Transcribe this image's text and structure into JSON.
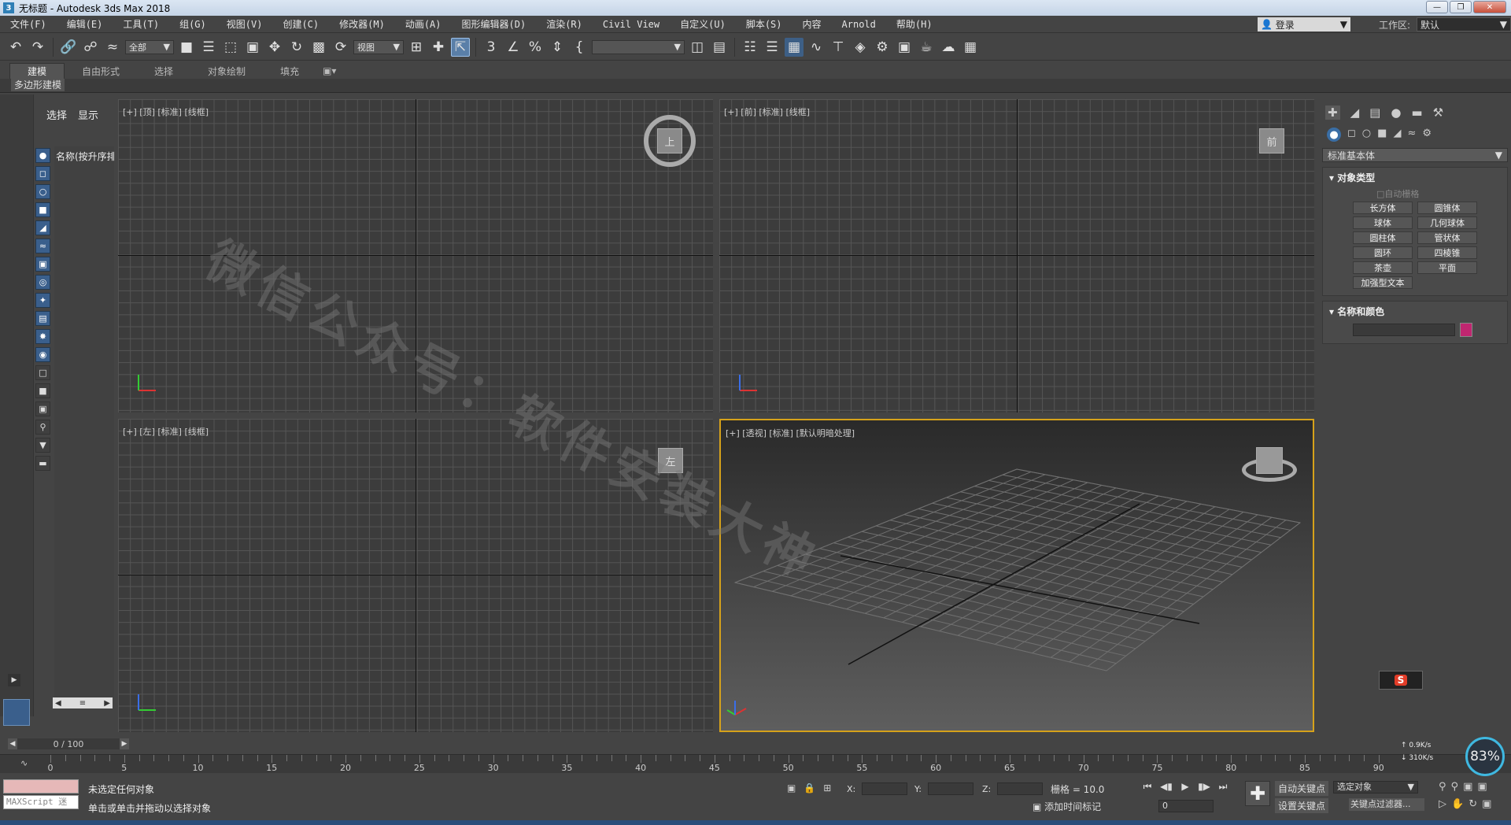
{
  "window": {
    "title": "无标题 - Autodesk 3ds Max 2018",
    "app_icon": "3"
  },
  "menu": [
    "文件(F)",
    "编辑(E)",
    "工具(T)",
    "组(G)",
    "视图(V)",
    "创建(C)",
    "修改器(M)",
    "动画(A)",
    "图形编辑器(D)",
    "渲染(R)",
    "Civil View",
    "自定义(U)",
    "脚本(S)",
    "内容",
    "Arnold",
    "帮助(H)"
  ],
  "account": {
    "login": "登录",
    "workspace_label": "工作区:",
    "workspace_value": "默认"
  },
  "toolbar": {
    "selection_filter": "全部",
    "ref_coord": "视图"
  },
  "ribbon": {
    "tabs": [
      "建模",
      "自由形式",
      "选择",
      "对象绘制",
      "填充"
    ],
    "active": "建模",
    "sub": "多边形建模"
  },
  "scene_explorer": {
    "tabs": [
      "选择",
      "显示"
    ],
    "column_header": "名称(按升序排"
  },
  "viewports": {
    "top": {
      "label": "[+] [顶] [标准] [线框]",
      "cube_label": "上"
    },
    "front": {
      "label": "[+] [前] [标准] [线框]",
      "cube_label": "前"
    },
    "left": {
      "label": "[+] [左] [标准] [线框]",
      "cube_label": "左"
    },
    "perspective": {
      "label": "[+] [透视] [标准] [默认明暗处理]"
    }
  },
  "watermark": "微信公众号：软件安装大神",
  "command_panel": {
    "category_dropdown": "标准基本体",
    "object_type_header": "对象类型",
    "autogrid": "自动栅格",
    "object_buttons": [
      "长方体",
      "圆锥体",
      "球体",
      "几何球体",
      "圆柱体",
      "管状体",
      "圆环",
      "四棱锥",
      "茶壶",
      "平面",
      "加强型文本"
    ],
    "name_color_header": "名称和颜色",
    "object_color": "#c02670"
  },
  "timeline": {
    "frame_display": "0 / 100",
    "tick_labels": [
      "0",
      "5",
      "10",
      "15",
      "20",
      "25",
      "30",
      "35",
      "40",
      "45",
      "50",
      "55",
      "60",
      "65",
      "70",
      "75",
      "80",
      "85",
      "90"
    ]
  },
  "status": {
    "line1": "未选定任何对象",
    "line2": "单击或单击并拖动以选择对象",
    "maxscript": "MAXScript 迷",
    "x_label": "X:",
    "y_label": "Y:",
    "z_label": "Z:",
    "grid": "栅格 = 10.0",
    "add_time_tag": "添加时间标记",
    "auto_key": "自动关键点",
    "set_key": "设置关键点",
    "selected_object": "选定对象",
    "key_filters": "关键点过滤器...",
    "current_frame": "0"
  },
  "performance": {
    "percent": "83%",
    "up": "0.9K/s",
    "down": "310K/s"
  },
  "ime": "S"
}
